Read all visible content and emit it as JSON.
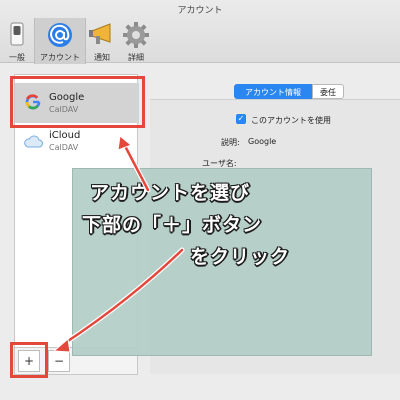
{
  "window": {
    "title": "アカウント"
  },
  "toolbar": {
    "items": [
      {
        "label": "一般",
        "icon": "switch-icon"
      },
      {
        "label": "アカウント",
        "icon": "at-sign-icon"
      },
      {
        "label": "通知",
        "icon": "megaphone-icon"
      },
      {
        "label": "詳細",
        "icon": "gear-icon"
      }
    ],
    "selected": "アカウント"
  },
  "accounts": [
    {
      "name": "Google",
      "type": "CalDAV",
      "icon": "google-icon",
      "selected": true
    },
    {
      "name": "iCloud",
      "type": "CalDAV",
      "icon": "icloud-icon",
      "selected": false
    }
  ],
  "list_buttons": {
    "add": "+",
    "remove": "−"
  },
  "detail": {
    "tabs": [
      {
        "label": "アカウント情報",
        "active": true
      },
      {
        "label": "委任",
        "active": false
      }
    ],
    "enable_checkbox": {
      "label": "このアカウントを使用",
      "checked": true
    },
    "description_label": "説明:",
    "description_value": "Google",
    "username_label": "ユーザ名:"
  },
  "annotation": {
    "lines": [
      "アカウントを選び",
      "下部の「＋」ボタン",
      "をクリック"
    ],
    "highlight_color": "#e4473b",
    "callout_bg": "#b2cdc6"
  }
}
